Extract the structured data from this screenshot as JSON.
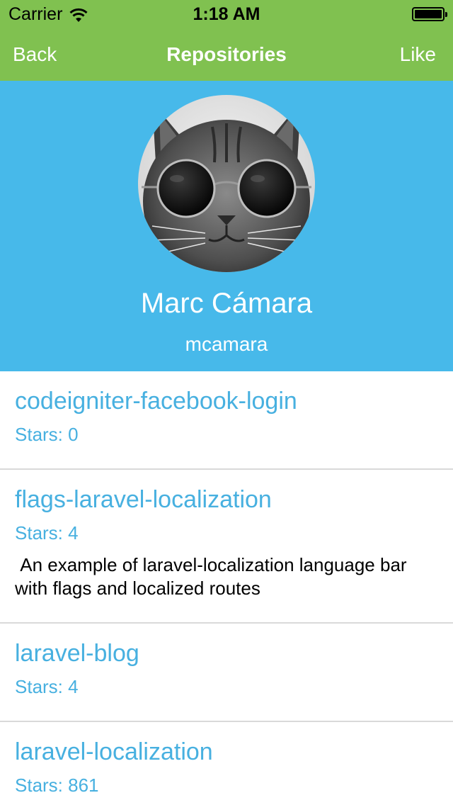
{
  "status_bar": {
    "carrier": "Carrier",
    "time": "1:18 AM"
  },
  "nav": {
    "back_label": "Back",
    "title": "Repositories",
    "like_label": "Like"
  },
  "profile": {
    "name": "Marc Cámara",
    "login": "mcamara"
  },
  "repositories": [
    {
      "name": "codeigniter-facebook-login",
      "stars": "Stars: 0",
      "description": ""
    },
    {
      "name": "flags-laravel-localization",
      "stars": "Stars: 4",
      "description": " An example of laravel-localization language bar with flags and localized routes"
    },
    {
      "name": "laravel-blog",
      "stars": "Stars: 4",
      "description": ""
    },
    {
      "name": "laravel-localization",
      "stars": "Stars: 861",
      "description": ""
    }
  ],
  "colors": {
    "nav_green": "#80c150",
    "header_blue": "#47b9ea",
    "link_blue": "#47b0e0"
  }
}
